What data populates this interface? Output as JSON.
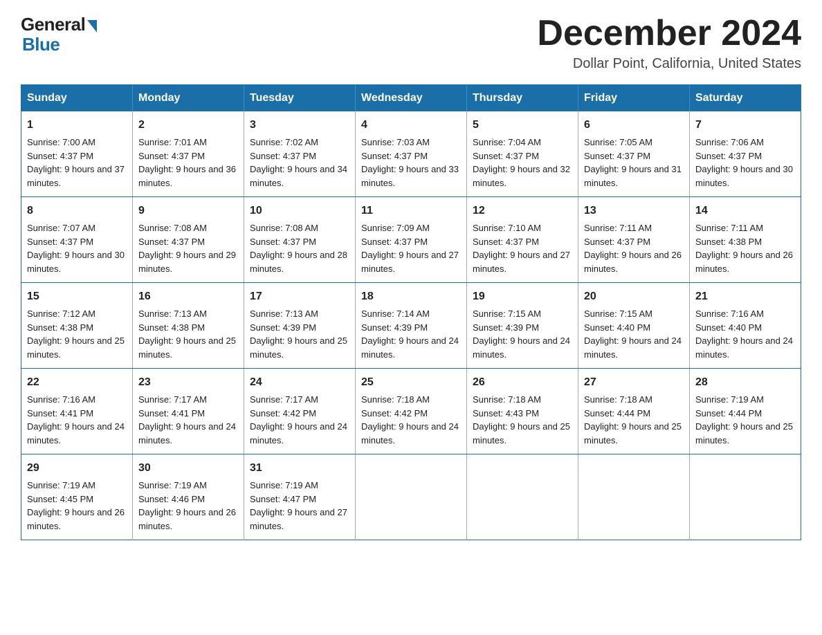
{
  "logo": {
    "general": "General",
    "blue": "Blue",
    "sub": "Blue"
  },
  "header": {
    "month_title": "December 2024",
    "location": "Dollar Point, California, United States"
  },
  "weekdays": [
    "Sunday",
    "Monday",
    "Tuesday",
    "Wednesday",
    "Thursday",
    "Friday",
    "Saturday"
  ],
  "weeks": [
    [
      {
        "day": "1",
        "sunrise": "7:00 AM",
        "sunset": "4:37 PM",
        "daylight": "9 hours and 37 minutes."
      },
      {
        "day": "2",
        "sunrise": "7:01 AM",
        "sunset": "4:37 PM",
        "daylight": "9 hours and 36 minutes."
      },
      {
        "day": "3",
        "sunrise": "7:02 AM",
        "sunset": "4:37 PM",
        "daylight": "9 hours and 34 minutes."
      },
      {
        "day": "4",
        "sunrise": "7:03 AM",
        "sunset": "4:37 PM",
        "daylight": "9 hours and 33 minutes."
      },
      {
        "day": "5",
        "sunrise": "7:04 AM",
        "sunset": "4:37 PM",
        "daylight": "9 hours and 32 minutes."
      },
      {
        "day": "6",
        "sunrise": "7:05 AM",
        "sunset": "4:37 PM",
        "daylight": "9 hours and 31 minutes."
      },
      {
        "day": "7",
        "sunrise": "7:06 AM",
        "sunset": "4:37 PM",
        "daylight": "9 hours and 30 minutes."
      }
    ],
    [
      {
        "day": "8",
        "sunrise": "7:07 AM",
        "sunset": "4:37 PM",
        "daylight": "9 hours and 30 minutes."
      },
      {
        "day": "9",
        "sunrise": "7:08 AM",
        "sunset": "4:37 PM",
        "daylight": "9 hours and 29 minutes."
      },
      {
        "day": "10",
        "sunrise": "7:08 AM",
        "sunset": "4:37 PM",
        "daylight": "9 hours and 28 minutes."
      },
      {
        "day": "11",
        "sunrise": "7:09 AM",
        "sunset": "4:37 PM",
        "daylight": "9 hours and 27 minutes."
      },
      {
        "day": "12",
        "sunrise": "7:10 AM",
        "sunset": "4:37 PM",
        "daylight": "9 hours and 27 minutes."
      },
      {
        "day": "13",
        "sunrise": "7:11 AM",
        "sunset": "4:37 PM",
        "daylight": "9 hours and 26 minutes."
      },
      {
        "day": "14",
        "sunrise": "7:11 AM",
        "sunset": "4:38 PM",
        "daylight": "9 hours and 26 minutes."
      }
    ],
    [
      {
        "day": "15",
        "sunrise": "7:12 AM",
        "sunset": "4:38 PM",
        "daylight": "9 hours and 25 minutes."
      },
      {
        "day": "16",
        "sunrise": "7:13 AM",
        "sunset": "4:38 PM",
        "daylight": "9 hours and 25 minutes."
      },
      {
        "day": "17",
        "sunrise": "7:13 AM",
        "sunset": "4:39 PM",
        "daylight": "9 hours and 25 minutes."
      },
      {
        "day": "18",
        "sunrise": "7:14 AM",
        "sunset": "4:39 PM",
        "daylight": "9 hours and 24 minutes."
      },
      {
        "day": "19",
        "sunrise": "7:15 AM",
        "sunset": "4:39 PM",
        "daylight": "9 hours and 24 minutes."
      },
      {
        "day": "20",
        "sunrise": "7:15 AM",
        "sunset": "4:40 PM",
        "daylight": "9 hours and 24 minutes."
      },
      {
        "day": "21",
        "sunrise": "7:16 AM",
        "sunset": "4:40 PM",
        "daylight": "9 hours and 24 minutes."
      }
    ],
    [
      {
        "day": "22",
        "sunrise": "7:16 AM",
        "sunset": "4:41 PM",
        "daylight": "9 hours and 24 minutes."
      },
      {
        "day": "23",
        "sunrise": "7:17 AM",
        "sunset": "4:41 PM",
        "daylight": "9 hours and 24 minutes."
      },
      {
        "day": "24",
        "sunrise": "7:17 AM",
        "sunset": "4:42 PM",
        "daylight": "9 hours and 24 minutes."
      },
      {
        "day": "25",
        "sunrise": "7:18 AM",
        "sunset": "4:42 PM",
        "daylight": "9 hours and 24 minutes."
      },
      {
        "day": "26",
        "sunrise": "7:18 AM",
        "sunset": "4:43 PM",
        "daylight": "9 hours and 25 minutes."
      },
      {
        "day": "27",
        "sunrise": "7:18 AM",
        "sunset": "4:44 PM",
        "daylight": "9 hours and 25 minutes."
      },
      {
        "day": "28",
        "sunrise": "7:19 AM",
        "sunset": "4:44 PM",
        "daylight": "9 hours and 25 minutes."
      }
    ],
    [
      {
        "day": "29",
        "sunrise": "7:19 AM",
        "sunset": "4:45 PM",
        "daylight": "9 hours and 26 minutes."
      },
      {
        "day": "30",
        "sunrise": "7:19 AM",
        "sunset": "4:46 PM",
        "daylight": "9 hours and 26 minutes."
      },
      {
        "day": "31",
        "sunrise": "7:19 AM",
        "sunset": "4:47 PM",
        "daylight": "9 hours and 27 minutes."
      },
      null,
      null,
      null,
      null
    ]
  ],
  "labels": {
    "sunrise": "Sunrise:",
    "sunset": "Sunset:",
    "daylight": "Daylight:"
  }
}
